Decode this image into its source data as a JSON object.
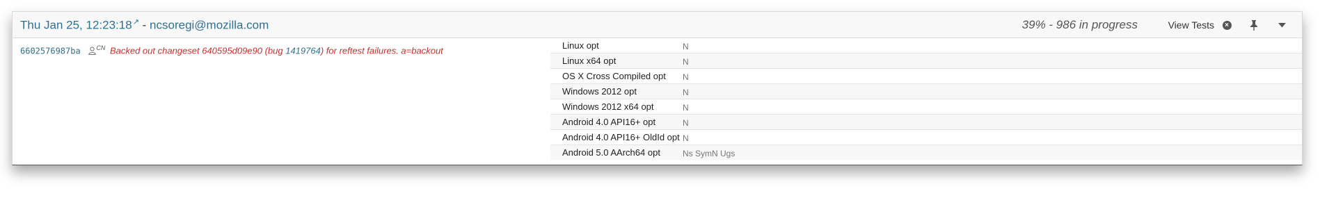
{
  "push": {
    "date": "Thu Jan 25, 12:23:18",
    "separator": "-",
    "author": "ncsoregi@mozilla.com",
    "external_link_icon": "external-link-icon",
    "progress": "39% - 986 in progress",
    "view_tests_label": "View Tests",
    "icons": {
      "close": "close-circle-icon",
      "pin": "pin-icon",
      "caret": "caret-down-icon"
    }
  },
  "revision": {
    "hash": "6602576987ba",
    "initials": "CN",
    "message_before": "Backed out changeset 640595d09e90 (bug ",
    "bug_number": "1419764",
    "message_after": ") for reftest failures. a=backout"
  },
  "jobs": [
    {
      "platform": "Linux opt",
      "groups": "N"
    },
    {
      "platform": "Linux x64 opt",
      "groups": "N"
    },
    {
      "platform": "OS X Cross Compiled opt",
      "groups": "N"
    },
    {
      "platform": "Windows 2012 opt",
      "groups": "N"
    },
    {
      "platform": "Windows 2012 x64 opt",
      "groups": "N"
    },
    {
      "platform": "Android 4.0 API16+ opt",
      "groups": "N"
    },
    {
      "platform": "Android 4.0 API16+ OldId opt",
      "groups": "N"
    },
    {
      "platform": "Android 5.0 AArch64 opt",
      "groups": "Ns SymN Ugs"
    }
  ],
  "colors": {
    "link": "#31708f",
    "commit_message": "#c9302c",
    "header_bg": "#f8f8f8"
  }
}
